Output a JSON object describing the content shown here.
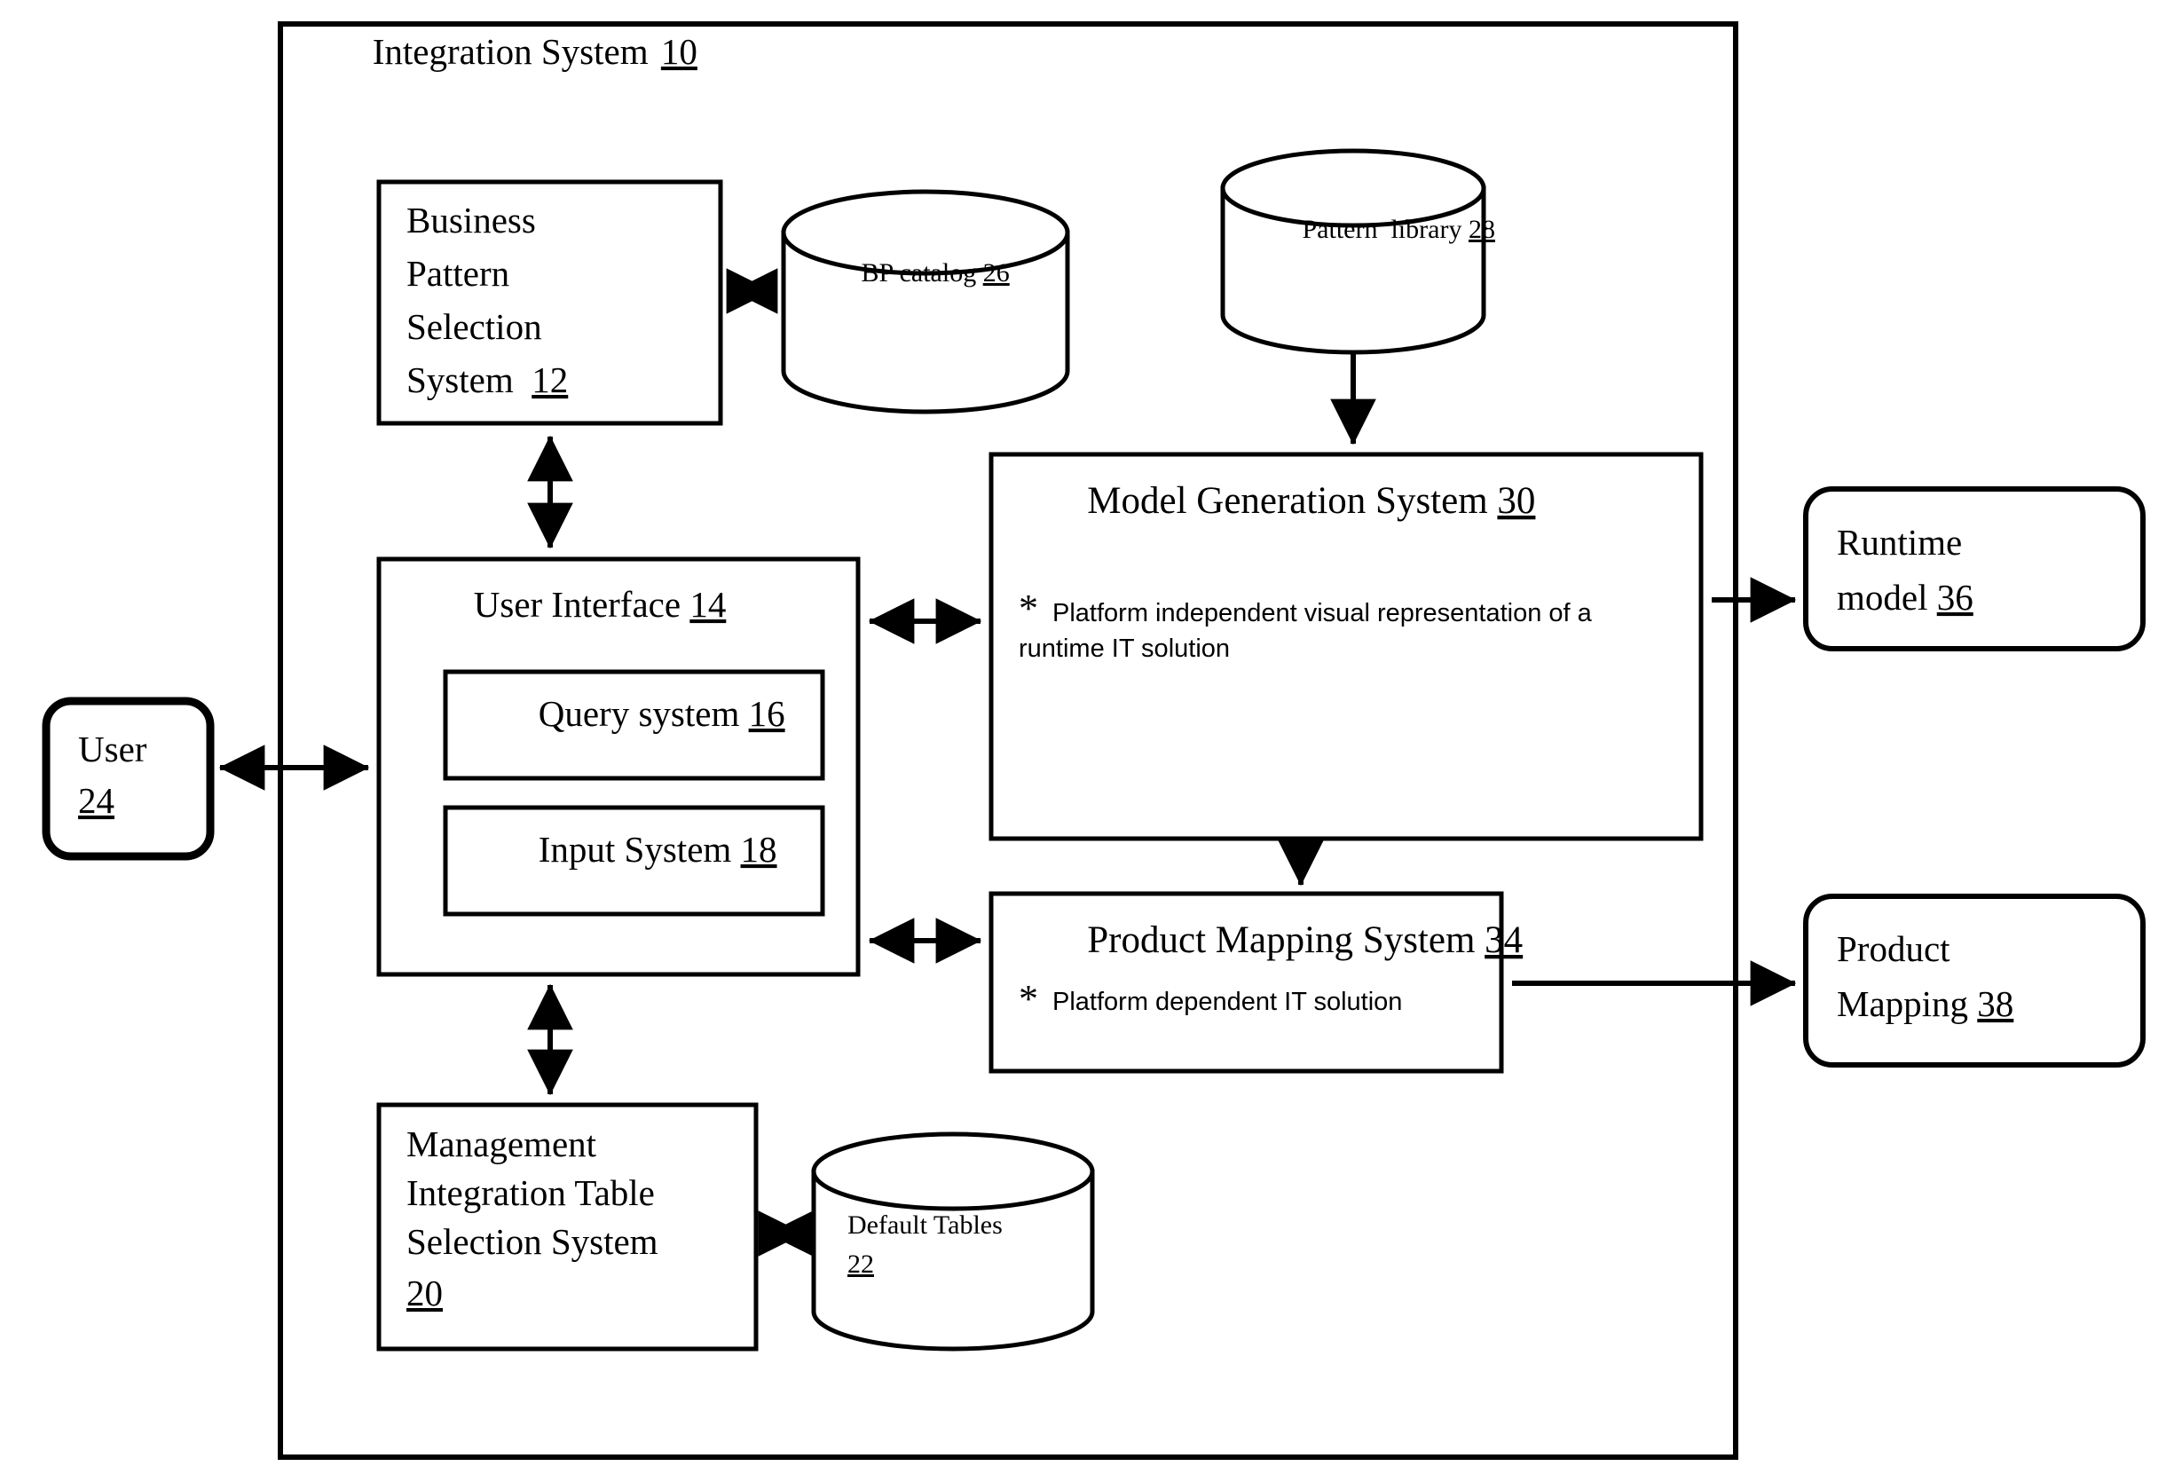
{
  "figure": {
    "frame": {
      "label": "Integration System",
      "ref": "10"
    },
    "boxes": [
      {
        "id": "business-pattern-selection-system",
        "lines": [
          "Business",
          "Pattern",
          "Selection",
          "System  "
        ],
        "ref": "12"
      },
      {
        "id": "user-interface",
        "lines": [
          "User Interface "
        ],
        "ref": "14",
        "children": [
          {
            "id": "query-system",
            "lines": [
              "Query system "
            ],
            "ref": "16"
          },
          {
            "id": "input-system",
            "lines": [
              "Input System "
            ],
            "ref": "18"
          }
        ]
      },
      {
        "id": "management-integration-table-selection-system",
        "lines": [
          "Management",
          "Integration Table",
          "Selection System"
        ],
        "ref": "20"
      },
      {
        "id": "model-generation-system",
        "lines": [
          "Model Generation System "
        ],
        "ref": "30",
        "bullet_marker": "*",
        "bullet_lines": [
          "Platform independent visual representation of a",
          "runtime IT solution"
        ]
      },
      {
        "id": "product-mapping-system",
        "lines": [
          "Product Mapping System "
        ],
        "ref": "34",
        "bullet_marker": "*",
        "bullet_lines": [
          "Platform dependent IT solution"
        ]
      }
    ],
    "cylinders": [
      {
        "id": "bp-catalog",
        "lines": [
          "BP catalog "
        ],
        "ref": "26"
      },
      {
        "id": "pattern-library",
        "lines": [
          "Pattern  library "
        ],
        "ref": "28"
      },
      {
        "id": "default-tables",
        "lines": [
          "Default Tables"
        ],
        "ref": "22"
      }
    ],
    "rounded_boxes": [
      {
        "id": "user",
        "lines": [
          "User"
        ],
        "ref": "24"
      },
      {
        "id": "runtime-model",
        "lines": [
          "Runtime",
          "model "
        ],
        "ref": "36"
      },
      {
        "id": "product-mapping",
        "lines": [
          "Product",
          "Mapping "
        ],
        "ref": "38"
      }
    ],
    "colors": {
      "stroke": "#000000",
      "background": "#ffffff",
      "text": "#000000"
    }
  }
}
